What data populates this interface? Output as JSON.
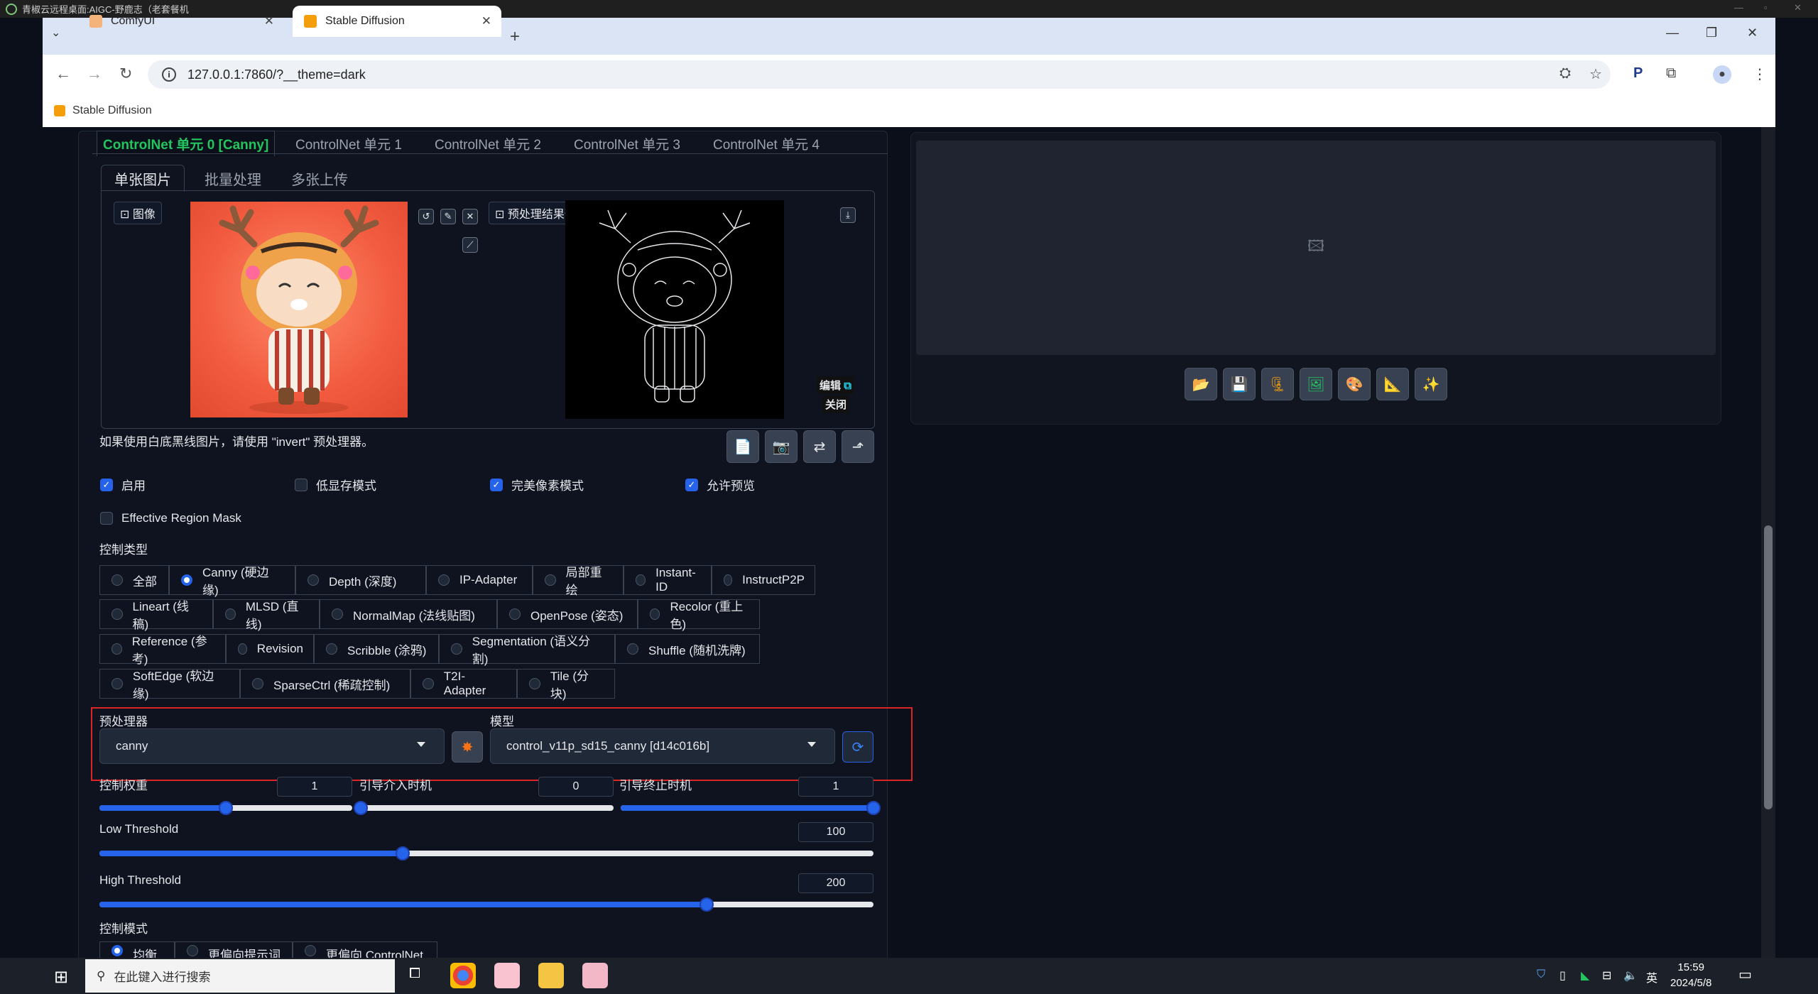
{
  "remote_desktop": {
    "title": "青椒云远程桌面:AIGC-野鹿志（老套餐机"
  },
  "browser": {
    "tabs": [
      {
        "label": "ComfyUI",
        "active": false
      },
      {
        "label": "Stable Diffusion",
        "active": true
      }
    ],
    "url": "127.0.0.1:7860/?__theme=dark",
    "bookmark": "Stable Diffusion"
  },
  "controlnet": {
    "unit_tabs": [
      "ControlNet 单元 0 [Canny]",
      "ControlNet 单元 1",
      "ControlNet 单元 2",
      "ControlNet 单元 3",
      "ControlNet 单元 4"
    ],
    "sub_tabs": [
      "单张图片",
      "批量处理",
      "多张上传"
    ],
    "image_label": "图像",
    "preview_label": "预处理结果预览",
    "edit_tag": "编辑",
    "close_tag": "关闭",
    "hint": "如果使用白底黑线图片，请使用 \"invert\" 预处理器。",
    "checkboxes": [
      {
        "label": "启用",
        "checked": true
      },
      {
        "label": "低显存模式",
        "checked": false
      },
      {
        "label": "完美像素模式",
        "checked": true
      },
      {
        "label": "允许预览",
        "checked": true
      }
    ],
    "effective_region_mask": "Effective Region Mask",
    "control_type_label": "控制类型",
    "control_types": [
      [
        "全部",
        "Canny (硬边缘)",
        "Depth (深度)",
        "IP-Adapter",
        "局部重绘",
        "Instant-ID",
        "InstructP2P"
      ],
      [
        "Lineart (线稿)",
        "MLSD (直线)",
        "NormalMap (法线贴图)",
        "OpenPose (姿态)",
        "Recolor (重上色)"
      ],
      [
        "Reference (参考)",
        "Revision",
        "Scribble (涂鸦)",
        "Segmentation (语义分割)",
        "Shuffle (随机洗牌)"
      ],
      [
        "SoftEdge (软边缘)",
        "SparseCtrl (稀疏控制)",
        "T2I-Adapter",
        "Tile (分块)"
      ]
    ],
    "selected_type": "Canny (硬边缘)",
    "preprocessor_label": "预处理器",
    "preprocessor_value": "canny",
    "model_label": "模型",
    "model_value": "control_v11p_sd15_canny [d14c016b]",
    "control_weight_label": "控制权重",
    "control_weight": "1",
    "start_label": "引导介入时机",
    "start_value": "0",
    "end_label": "引导终止时机",
    "end_value": "1",
    "low_threshold_label": "Low Threshold",
    "low_threshold": "100",
    "high_threshold_label": "High Threshold",
    "high_threshold": "200",
    "control_mode_label": "控制模式",
    "control_modes": [
      "均衡",
      "更偏向提示词",
      "更偏向 ControlNet"
    ],
    "slider_levels": {
      "weight": 0.5,
      "start": 0.0,
      "end": 1.0,
      "low": 0.392,
      "high": 0.784
    }
  },
  "taskbar": {
    "search_placeholder": "在此键入进行搜索",
    "time": "15:59",
    "date": "2024/5/8",
    "ime": "英"
  }
}
